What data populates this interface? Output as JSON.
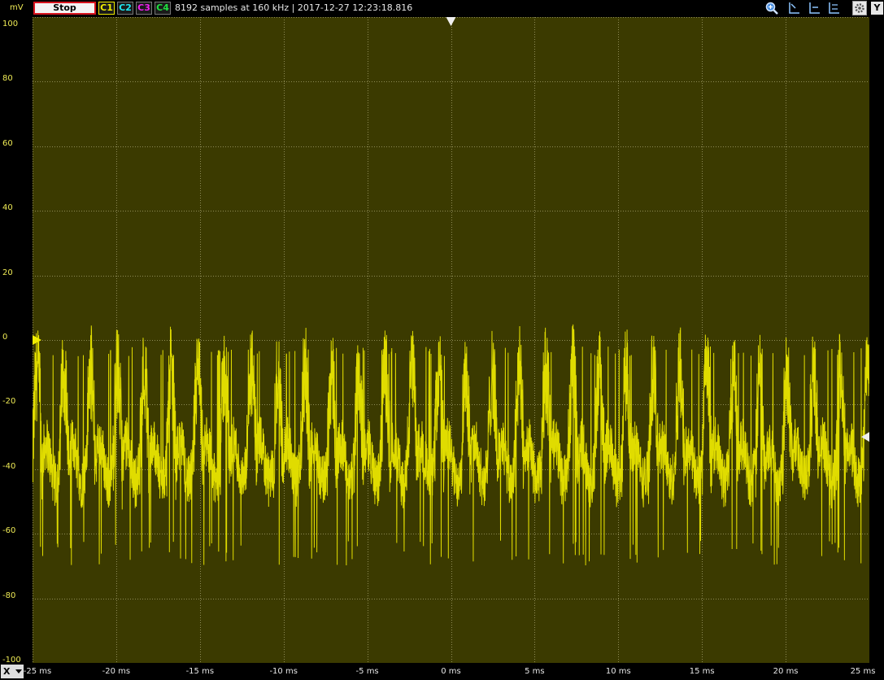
{
  "toolbar": {
    "stop_label": "Stop",
    "channels": [
      {
        "label": "C1",
        "color": "#f0ec00",
        "active": true
      },
      {
        "label": "C2",
        "color": "#1ee6f0",
        "active": false
      },
      {
        "label": "C3",
        "color": "#f020f0",
        "active": false
      },
      {
        "label": "C4",
        "color": "#20e040",
        "active": false
      }
    ],
    "info": "8192 samples at 160 kHz | 2017-12-27 12:23:18.816",
    "tools": [
      "zoom-icon",
      "cursor-a-icon",
      "cursor-b-icon",
      "cursor-c-icon",
      "cursor-d-icon",
      "settings-icon"
    ],
    "y_button_label": "Y"
  },
  "x_button_label": "X",
  "chart_data": {
    "type": "line",
    "unit_label": "mV",
    "ylim": [
      -100,
      100
    ],
    "xlim": [
      -25,
      25
    ],
    "yticks": [
      "100",
      "80",
      "60",
      "40",
      "20",
      "0",
      "-20",
      "-40",
      "-60",
      "-80",
      "-100"
    ],
    "xticks": [
      "-25 ms",
      "-20 ms",
      "-15 ms",
      "-10 ms",
      "-5 ms",
      "0 ms",
      "5 ms",
      "10 ms",
      "15 ms",
      "20 ms",
      "25 ms"
    ],
    "grid": true,
    "trigger_level": 0,
    "trigger_time": 0,
    "series": [
      {
        "channel": "C1",
        "color": "#e0dc00",
        "period_ms": 1.6,
        "baseline": -38,
        "peak": -5,
        "trough": -62
      }
    ]
  }
}
